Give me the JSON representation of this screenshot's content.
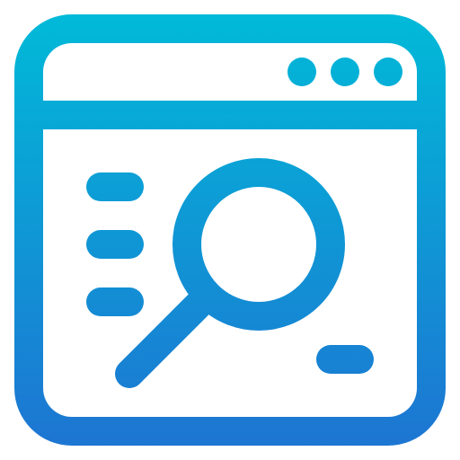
{
  "icon": {
    "name": "browser-search-icon",
    "gradient": {
      "top_color": "#00BCD8",
      "bottom_color": "#1E73D2"
    },
    "window_dots": 3,
    "content_lines": 3
  }
}
